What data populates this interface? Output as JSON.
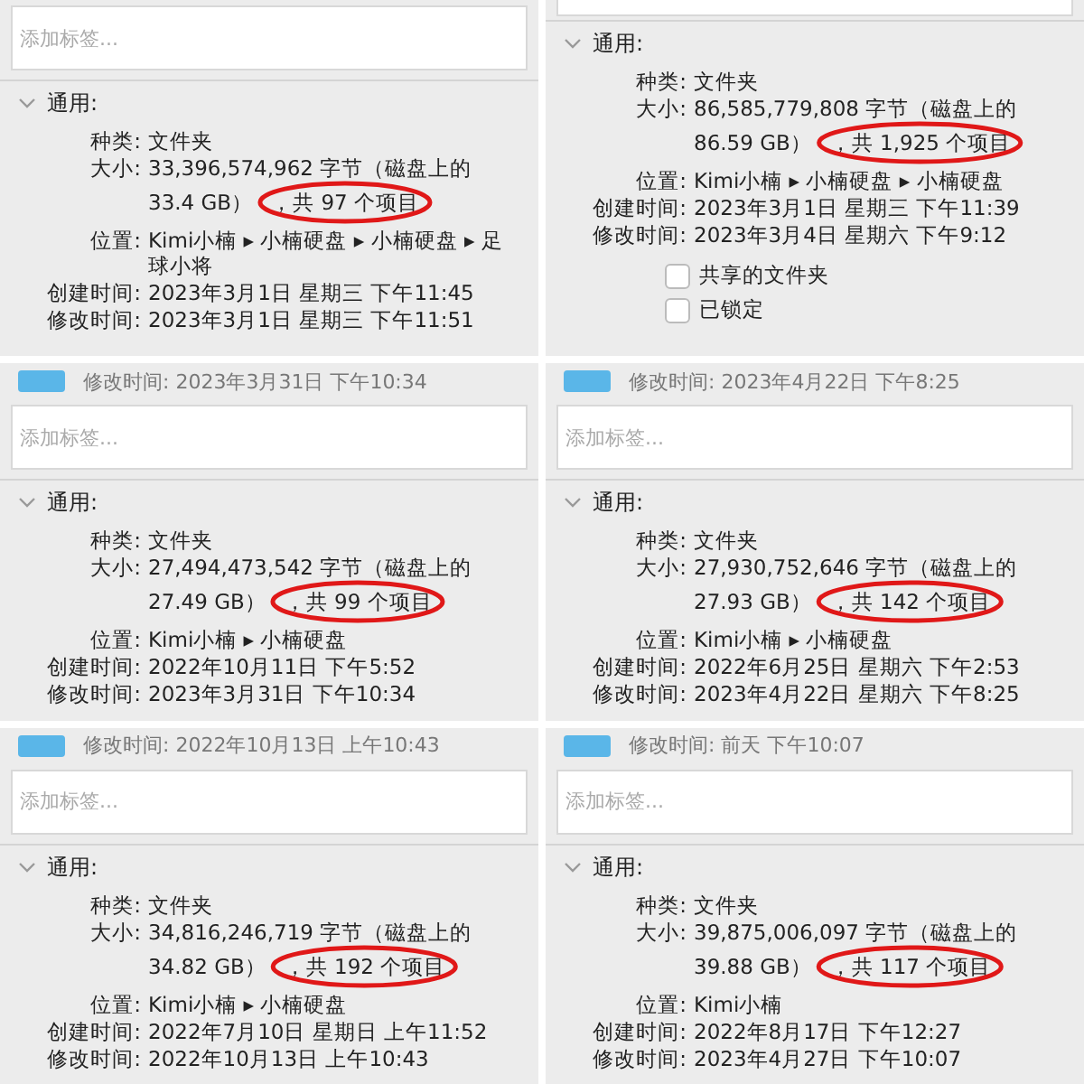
{
  "panels": [
    {
      "tag_placeholder": "添加标签...",
      "section": "通用:",
      "expanded": true,
      "rows": [
        {
          "label": "种类:",
          "value": "文件夹"
        },
        {
          "label": "大小:",
          "value": "33,396,574,962 字节（磁盘上的",
          "value_line2": "33.4 GB）",
          "count": "，共 97 个项目",
          "circled": true
        },
        {
          "label": "位置:",
          "value": "Kimi小楠 ▸ 小楠硬盘 ▸ 小楠硬盘 ▸ 足球小将"
        },
        {
          "label": "创建时间:",
          "value": "2023年3月1日 星期三 下午11:45"
        },
        {
          "label": "修改时间:",
          "value": "2023年3月1日 星期三 下午11:51"
        }
      ]
    },
    {
      "section": "通用:",
      "expanded": true,
      "rows": [
        {
          "label": "种类:",
          "value": "文件夹"
        },
        {
          "label": "大小:",
          "value": "86,585,779,808 字节（磁盘上的",
          "value_line2": "86.59 GB）",
          "count": "，共 1,925 个项目",
          "circled": true
        },
        {
          "label": "位置:",
          "value": "Kimi小楠 ▸ 小楠硬盘 ▸ 小楠硬盘"
        },
        {
          "label": "创建时间:",
          "value": "2023年3月1日 星期三 下午11:39"
        },
        {
          "label": "修改时间:",
          "value": "2023年3月4日 星期六 下午9:12"
        }
      ],
      "checkboxes": [
        {
          "label": "共享的文件夹",
          "checked": false
        },
        {
          "label": "已锁定",
          "checked": false
        }
      ]
    },
    {
      "header": "修改时间: 2023年3月31日 下午10:34",
      "tag_placeholder": "添加标签...",
      "section": "通用:",
      "expanded": true,
      "rows": [
        {
          "label": "种类:",
          "value": "文件夹"
        },
        {
          "label": "大小:",
          "value": "27,494,473,542 字节（磁盘上的",
          "value_line2": "27.49 GB）",
          "count": "，共 99 个项目",
          "circled": true
        },
        {
          "label": "位置:",
          "value": "Kimi小楠 ▸ 小楠硬盘"
        },
        {
          "label": "创建时间:",
          "value": "2022年10月11日 下午5:52"
        },
        {
          "label": "修改时间:",
          "value": "2023年3月31日 下午10:34"
        }
      ]
    },
    {
      "header": "修改时间: 2023年4月22日 下午8:25",
      "tag_placeholder": "添加标签...",
      "section": "通用:",
      "expanded": true,
      "rows": [
        {
          "label": "种类:",
          "value": "文件夹"
        },
        {
          "label": "大小:",
          "value": "27,930,752,646 字节（磁盘上的",
          "value_line2": "27.93 GB）",
          "count": "，共 142 个项目",
          "circled": true
        },
        {
          "label": "位置:",
          "value": "Kimi小楠 ▸ 小楠硬盘"
        },
        {
          "label": "创建时间:",
          "value": "2022年6月25日 星期六 下午2:53"
        },
        {
          "label": "修改时间:",
          "value": "2023年4月22日 星期六 下午8:25"
        }
      ]
    },
    {
      "header": "修改时间: 2022年10月13日 上午10:43",
      "tag_placeholder": "添加标签...",
      "section": "通用:",
      "expanded": true,
      "rows": [
        {
          "label": "种类:",
          "value": "文件夹"
        },
        {
          "label": "大小:",
          "value": "34,816,246,719 字节（磁盘上的",
          "value_line2": "34.82 GB）",
          "count": "，共 192 个项目",
          "circled": true
        },
        {
          "label": "位置:",
          "value": "Kimi小楠 ▸ 小楠硬盘"
        },
        {
          "label": "创建时间:",
          "value": "2022年7月10日 星期日 上午11:52"
        },
        {
          "label": "修改时间:",
          "value": "2022年10月13日 上午10:43"
        }
      ]
    },
    {
      "header": "修改时间: 前天 下午10:07",
      "tag_placeholder": "添加标签...",
      "section": "通用:",
      "expanded": true,
      "rows": [
        {
          "label": "种类:",
          "value": "文件夹"
        },
        {
          "label": "大小:",
          "value": "39,875,006,097 字节（磁盘上的",
          "value_line2": "39.88 GB）",
          "count": "，共 117 个项目",
          "circled": true
        },
        {
          "label": "位置:",
          "value": "Kimi小楠"
        },
        {
          "label": "创建时间:",
          "value": "2022年8月17日 下午12:27"
        },
        {
          "label": "修改时间:",
          "value": "2023年4月27日 下午10:07"
        }
      ]
    }
  ]
}
